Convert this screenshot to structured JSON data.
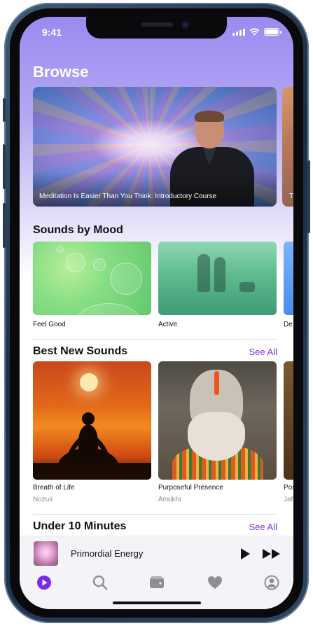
{
  "status": {
    "time": "9:41"
  },
  "header": {
    "title": "Browse"
  },
  "hero": {
    "caption": "Meditation Is Easier Than You Think: Introductory Course",
    "peek_caption": "T"
  },
  "mood": {
    "title": "Sounds by Mood",
    "items": [
      {
        "label": "Feel Good"
      },
      {
        "label": "Active"
      },
      {
        "label": "De"
      }
    ]
  },
  "best_new": {
    "title": "Best New Sounds",
    "see_all": "See All",
    "items": [
      {
        "label": "Breath of Life",
        "artist": "Nozuii"
      },
      {
        "label": "Purposeful Presence",
        "artist": "Ansikhi"
      },
      {
        "label": "Pos",
        "artist": "Jaf"
      }
    ]
  },
  "under10": {
    "title": "Under 10 Minutes",
    "see_all": "See All"
  },
  "player": {
    "title": "Primordial Energy"
  },
  "tabs": {
    "items": [
      {
        "icon": "play-circle-icon",
        "active": true
      },
      {
        "icon": "search-icon",
        "active": false
      },
      {
        "icon": "wallet-icon",
        "active": false
      },
      {
        "icon": "heart-icon",
        "active": false
      },
      {
        "icon": "profile-icon",
        "active": false
      }
    ]
  },
  "colors": {
    "accent": "#8a2be2",
    "active_tab": "#7c2ae8",
    "inactive_tab": "#8e8e93"
  }
}
